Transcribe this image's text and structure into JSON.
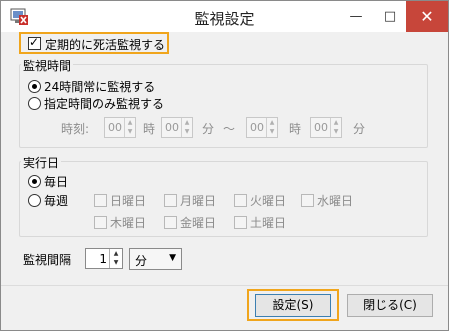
{
  "window": {
    "title": "監視設定",
    "minimize_icon": "minimize-icon",
    "maximize_icon": "maximize-icon",
    "close_icon": "close-icon",
    "close_color": "#c7463a"
  },
  "main_checkbox": {
    "label": "定期的に死活監視する",
    "checked": true
  },
  "watch_time": {
    "group_label": "監視時間",
    "options": [
      {
        "label": "24時間常に監視する",
        "selected": true
      },
      {
        "label": "指定時間のみ監視する",
        "selected": false
      }
    ],
    "time_label": "時刻:",
    "start_hour": "00",
    "hour_unit": "時",
    "start_min": "00",
    "min_unit": "分",
    "range_sep": "～",
    "end_hour": "00",
    "end_min": "00"
  },
  "run_days": {
    "group_label": "実行日",
    "options": [
      {
        "label": "毎日",
        "selected": true
      },
      {
        "label": "毎週",
        "selected": false
      }
    ],
    "weekdays": [
      "日曜日",
      "月曜日",
      "火曜日",
      "水曜日",
      "木曜日",
      "金曜日",
      "土曜日"
    ]
  },
  "interval": {
    "label": "監視間隔",
    "value": "1",
    "unit": "分"
  },
  "buttons": {
    "ok": "設定(S)",
    "close": "閉じる(C)"
  },
  "highlight_color": "#f0a51c"
}
